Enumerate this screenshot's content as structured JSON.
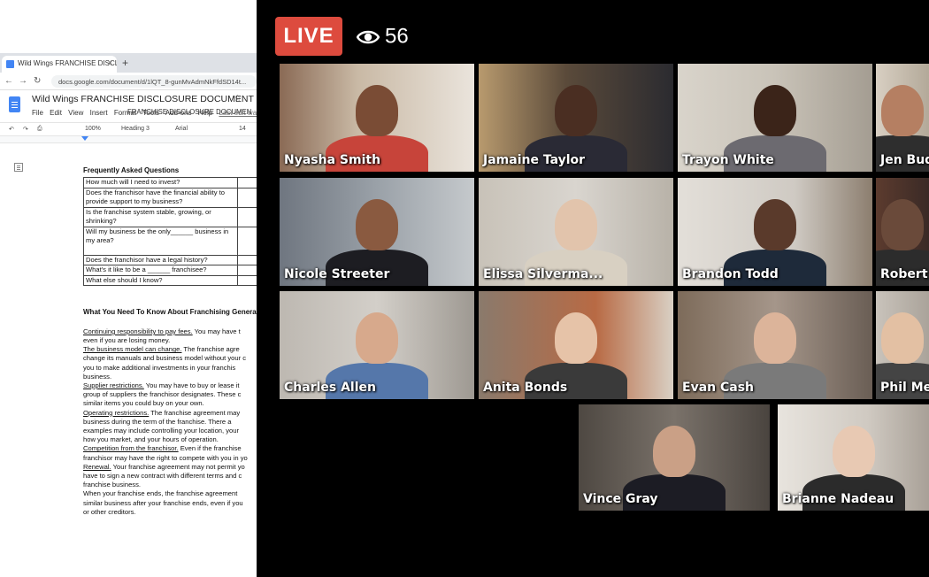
{
  "browser": {
    "tab_title": "Wild Wings FRANCHISE DISCLOSU",
    "tab_close": "×",
    "new_tab": "+",
    "url": "docs.google.com/document/d/1lQT_8-gunMvAdmNkFfdSD14t..."
  },
  "doc": {
    "title": "Wild Wings FRANCHISE DISCLOSURE DOCUMENT",
    "menus": [
      "File",
      "Edit",
      "View",
      "Insert",
      "Format",
      "Tools",
      "Add-ons",
      "Help"
    ],
    "last_edit": "Last edit wa",
    "toolbar": {
      "zoom": "100%",
      "style": "Heading 3",
      "font": "Arial",
      "size": "14"
    },
    "header_cut": "FRANCHISE DISCLOSURE DOCUMEN",
    "faq_heading": "Frequently Asked Questions",
    "faq": [
      "How much will I need to invest?",
      "Does the franchisor have the financial ability to provide support to my business?",
      "Is the franchise system stable, growing, or shrinking?",
      "Will my business be the only______ business in my area?",
      "Does the franchisor have a legal history?",
      "What's it like to be a ______ franchisee?",
      "What else should I know?"
    ],
    "know_heading": "What You Need To Know About Franchising Genera",
    "lines": [
      "Continuing responsibility to pay fees. You may have t",
      "even if you are losing money.",
      "The business model can change. The franchise agre",
      "change its manuals and business model without your c",
      "you to make additional investments in your franchis",
      "business.",
      "Supplier restrictions. You may have to buy or lease it",
      "group of suppliers the franchisor designates. These c",
      "similar items you could buy on your own.",
      "Operating restrictions. The franchise agreement may",
      "business during the term of the franchise. There a",
      "examples may include controlling your location, your",
      "how you market, and your hours of operation.",
      "Competition from the franchisor. Even if the franchise",
      "franchisor may have the right to compete with you in yo",
      "Renewal. Your franchise agreement may not permit yo",
      "have to sign a new contract with different terms and c",
      "franchise business.",
      "When your franchise ends, the franchise agreement",
      "similar business after your franchise ends, even if you",
      "or other creditors."
    ]
  },
  "stream": {
    "live_label": "LIVE",
    "viewer_count": "56",
    "live_color": "#dd4b3e",
    "active_speaker_color": "#4cd137"
  },
  "participants": [
    {
      "name": "Nyasha Smith",
      "active": true
    },
    {
      "name": "Jamaine Taylor",
      "active": false
    },
    {
      "name": "Trayon White",
      "active": false
    },
    {
      "name": "Jen Budo",
      "active": false
    },
    {
      "name": "Nicole Streeter",
      "active": false
    },
    {
      "name": "Elissa Silverma...",
      "active": false
    },
    {
      "name": "Brandon Todd",
      "active": false
    },
    {
      "name": "Robert W",
      "active": false
    },
    {
      "name": "Charles Allen",
      "active": false
    },
    {
      "name": "Anita Bonds",
      "active": false
    },
    {
      "name": "Evan Cash",
      "active": false
    },
    {
      "name": "Phil Mend",
      "active": false
    },
    {
      "name": "Vince Gray",
      "active": false
    },
    {
      "name": "Brianne Nadeau",
      "active": false
    }
  ]
}
